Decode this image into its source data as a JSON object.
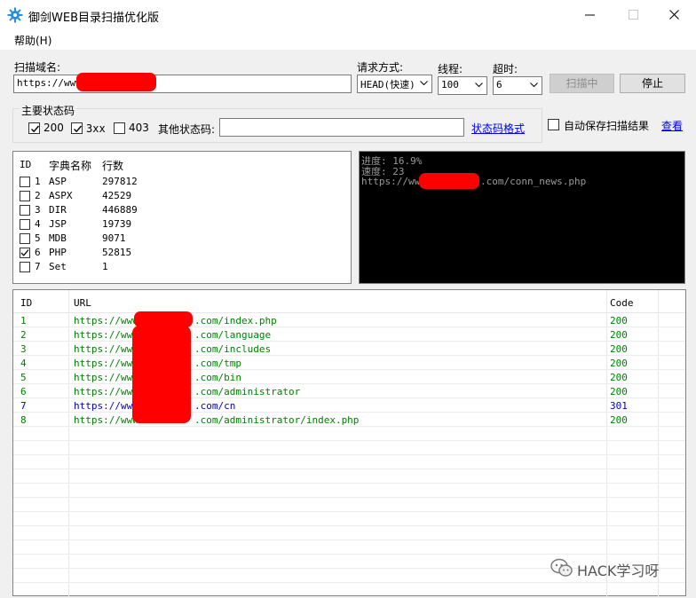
{
  "window": {
    "title": "御剑WEB目录扫描优化版"
  },
  "menu": {
    "help": "帮助(H)"
  },
  "scan": {
    "domain_label": "扫描域名:",
    "domain_value": "https://www.",
    "method_label": "请求方式:",
    "method_value": "HEAD(快速)",
    "threads_label": "线程:",
    "threads_value": "100",
    "timeout_label": "超时:",
    "timeout_value": "6",
    "scanning_button": "扫描中",
    "stop_button": "停止"
  },
  "status_codes": {
    "group_title": "主要状态码",
    "code_200": "200",
    "code_3xx": "3xx",
    "code_403": "403",
    "checked_200": true,
    "checked_3xx": true,
    "checked_403": false,
    "other_label": "其他状态码:",
    "other_value": "",
    "format_link": "状态码格式"
  },
  "auto_save": {
    "label": "自动保存扫描结果",
    "checked": false,
    "view_link": "查看"
  },
  "dict": {
    "headers": {
      "id": "ID",
      "name": "字典名称",
      "lines": "行数"
    },
    "rows": [
      {
        "id": "1",
        "name": "ASP",
        "lines": "297812",
        "checked": false
      },
      {
        "id": "2",
        "name": "ASPX",
        "lines": "42529",
        "checked": false
      },
      {
        "id": "3",
        "name": "DIR",
        "lines": "446889",
        "checked": false
      },
      {
        "id": "4",
        "name": "JSP",
        "lines": "19739",
        "checked": false
      },
      {
        "id": "5",
        "name": "MDB",
        "lines": "9071",
        "checked": false
      },
      {
        "id": "6",
        "name": "PHP",
        "lines": "52815",
        "checked": true
      },
      {
        "id": "7",
        "name": "Set",
        "lines": "1",
        "checked": false
      }
    ]
  },
  "console": {
    "progress": "进度: 16.9%",
    "speed": "速度: 23",
    "url_prefix": "https://www",
    "url_suffix": ".com/conn_news.php"
  },
  "results": {
    "headers": {
      "id": "ID",
      "url": "URL",
      "code": "Code"
    },
    "rows": [
      {
        "id": "1",
        "prefix": "https://www",
        "suffix": ".com/index.php",
        "code": "200",
        "color": "#008000"
      },
      {
        "id": "2",
        "prefix": "https://www",
        "suffix": ".com/language",
        "code": "200",
        "color": "#008000"
      },
      {
        "id": "3",
        "prefix": "https://www",
        "suffix": ".com/includes",
        "code": "200",
        "color": "#008000"
      },
      {
        "id": "4",
        "prefix": "https://www",
        "suffix": ".com/tmp",
        "code": "200",
        "color": "#008000"
      },
      {
        "id": "5",
        "prefix": "https://www",
        "suffix": ".com/bin",
        "code": "200",
        "color": "#008000"
      },
      {
        "id": "6",
        "prefix": "https://www",
        "suffix": ".com/administrator",
        "code": "200",
        "color": "#008000"
      },
      {
        "id": "7",
        "prefix": "https://www",
        "suffix": ".com/cn",
        "code": "301",
        "color": "#0000cc"
      },
      {
        "id": "8",
        "prefix": "https://www",
        "suffix": ".com/administrator/index.php",
        "code": "200",
        "color": "#008000"
      }
    ]
  },
  "watermark": {
    "text": "HACK学习呀"
  },
  "colors": {
    "redaction": "#ff0000",
    "ok_green": "#008000",
    "redirect_blue": "#0000cc",
    "link_blue": "#0000ee",
    "console_bg": "#000000"
  }
}
